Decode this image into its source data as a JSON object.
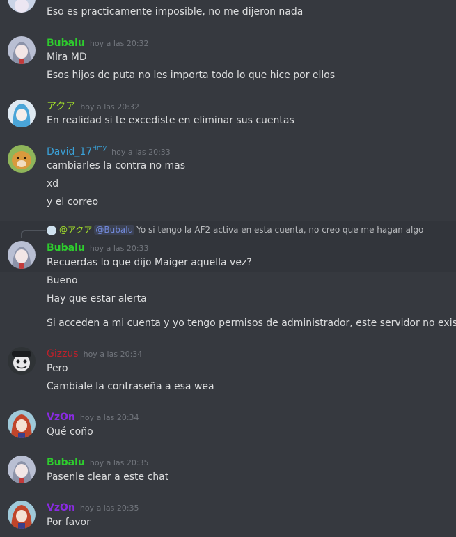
{
  "messages": [
    {
      "text": "Eso es practicamente imposible, no me dijeron nada"
    },
    {
      "author": "Bubalu",
      "time": "hoy a las 20:32",
      "lines": [
        "Mira MD",
        "Esos hijos de puta no les importa todo lo que hice por ellos"
      ]
    },
    {
      "author": "アクア",
      "time": "hoy a las 20:32",
      "lines": [
        "En realidad si te excediste en eliminar sus cuentas"
      ]
    },
    {
      "author": "David_17",
      "tag": "Hmy",
      "time": "hoy a las 20:33",
      "lines": [
        "cambiarles la contra no mas",
        "xd",
        "y el correo"
      ]
    },
    {
      "reply": {
        "user": "@アクア",
        "mention": "@Bubalu",
        "text": "Yo si tengo la AF2 activa en esta cuenta, no creo que me hagan algo"
      },
      "author": "Bubalu",
      "time": "hoy a las 20:33",
      "lines": [
        "Recuerdas lo que dijo Maiger aquella vez?",
        "Bueno",
        "Hay que estar alerta",
        "Si acceden a mi cuenta y yo tengo permisos de administrador, este servidor no existe"
      ]
    },
    {
      "author": "Gizzus",
      "time": "hoy a las 20:34",
      "lines": [
        "Pero",
        "Cambiale la contraseña a esa wea"
      ]
    },
    {
      "author": "VzOn",
      "time": "hoy a las 20:34",
      "lines": [
        "Qué coño"
      ]
    },
    {
      "author": "Bubalu",
      "time": "hoy a las 20:35",
      "lines": [
        "Pasenle clear a este chat"
      ]
    },
    {
      "author": "VzOn",
      "time": "hoy a las 20:35",
      "lines": [
        "Por favor"
      ]
    }
  ],
  "colors": {
    "background": "#36393f",
    "bubalu": "#2ecc2e",
    "aqua": "#a3e02a",
    "david": "#3aa0d6",
    "gizzus": "#c0202a",
    "vzon": "#8a2be2",
    "new_divider": "#f04747"
  }
}
